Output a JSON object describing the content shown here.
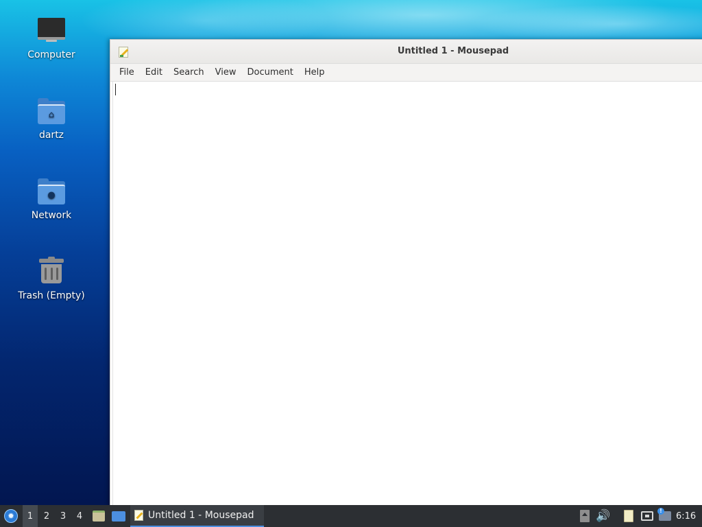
{
  "desktop": {
    "icons": [
      {
        "label": "Computer",
        "icon": "computer-icon"
      },
      {
        "label": "dartz",
        "icon": "home-folder-icon"
      },
      {
        "label": "Network",
        "icon": "network-folder-icon"
      },
      {
        "label": "Trash (Empty)",
        "icon": "trash-icon"
      }
    ]
  },
  "window": {
    "title": "Untitled 1 - Mousepad",
    "app_icon": "mousepad-icon",
    "menu": [
      "File",
      "Edit",
      "Search",
      "View",
      "Document",
      "Help"
    ],
    "editor_text": ""
  },
  "taskbar": {
    "start_icon": "start-menu-icon",
    "workspaces": [
      "1",
      "2",
      "3",
      "4"
    ],
    "active_workspace": "1",
    "launchers": [
      "file-manager-icon",
      "show-desktop-icon"
    ],
    "tasks": [
      {
        "label": "Untitled 1 - Mousepad",
        "icon": "mousepad-icon"
      }
    ],
    "tray": [
      "eject-icon",
      "volume-icon",
      "clipboard-icon",
      "network-icon",
      "updates-icon"
    ],
    "clock": "6:16"
  },
  "colors": {
    "taskbar_bg": "#2c2f33",
    "task_accent": "#4c8fe0",
    "desktop_top": "#19c2e6",
    "desktop_bottom": "#021650"
  }
}
